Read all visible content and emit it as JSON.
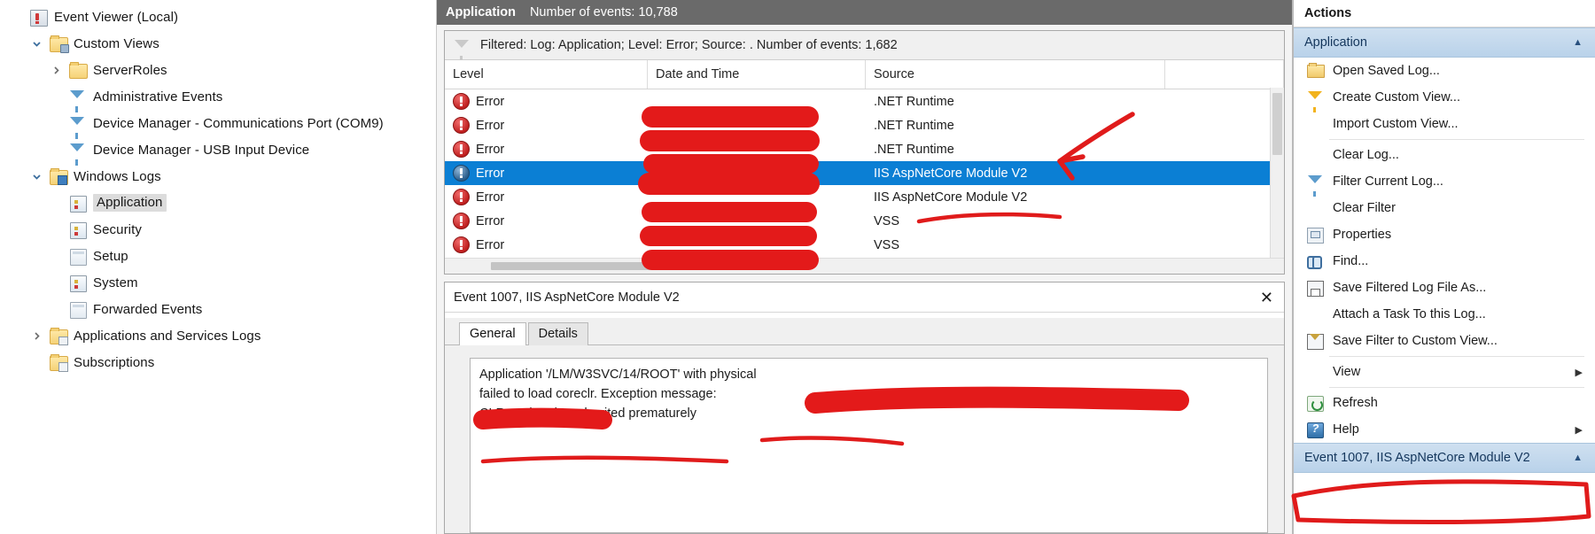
{
  "tree": {
    "items": [
      {
        "label": "Event Viewer (Local)",
        "icon": "event-viewer-icon",
        "indent": 0,
        "twisty": "",
        "selected": false
      },
      {
        "label": "Custom Views",
        "icon": "custom-views-folder-icon",
        "indent": 1,
        "twisty": "expanded",
        "selected": false
      },
      {
        "label": "ServerRoles",
        "icon": "folder-icon",
        "indent": 2,
        "twisty": "collapsed",
        "selected": false
      },
      {
        "label": "Administrative Events",
        "icon": "funnel-icon",
        "indent": 2,
        "twisty": "",
        "selected": false
      },
      {
        "label": "Device Manager - Communications Port (COM9)",
        "icon": "funnel-icon",
        "indent": 2,
        "twisty": "",
        "selected": false
      },
      {
        "label": "Device Manager - USB Input Device",
        "icon": "funnel-icon",
        "indent": 2,
        "twisty": "",
        "selected": false
      },
      {
        "label": "Windows Logs",
        "icon": "windows-logs-folder-icon",
        "indent": 1,
        "twisty": "expanded",
        "selected": false
      },
      {
        "label": "Application",
        "icon": "log-icon",
        "indent": 2,
        "twisty": "",
        "selected": true
      },
      {
        "label": "Security",
        "icon": "log-icon",
        "indent": 2,
        "twisty": "",
        "selected": false
      },
      {
        "label": "Setup",
        "icon": "plain-log-icon",
        "indent": 2,
        "twisty": "",
        "selected": false
      },
      {
        "label": "System",
        "icon": "log-icon",
        "indent": 2,
        "twisty": "",
        "selected": false
      },
      {
        "label": "Forwarded Events",
        "icon": "plain-log-icon",
        "indent": 2,
        "twisty": "",
        "selected": false
      },
      {
        "label": "Applications and Services Logs",
        "icon": "app-services-folder-icon",
        "indent": 1,
        "twisty": "collapsed",
        "selected": false
      },
      {
        "label": "Subscriptions",
        "icon": "subscriptions-folder-icon",
        "indent": 1,
        "twisty": "",
        "selected": false
      }
    ]
  },
  "center": {
    "log_title": "Application",
    "log_count": "Number of events: 10,788",
    "filter_text": "Filtered: Log: Application; Level: Error; Source: . Number of events: 1,682",
    "columns": [
      "Level",
      "Date and Time",
      "Source"
    ],
    "rows": [
      {
        "level": "Error",
        "date": "",
        "source": ".NET Runtime",
        "selected": false
      },
      {
        "level": "Error",
        "date": "",
        "source": ".NET Runtime",
        "selected": false
      },
      {
        "level": "Error",
        "date": "",
        "source": ".NET Runtime",
        "selected": false
      },
      {
        "level": "Error",
        "date": "",
        "source": "IIS AspNetCore Module V2",
        "selected": true
      },
      {
        "level": "Error",
        "date": "",
        "source": "IIS AspNetCore Module V2",
        "selected": false
      },
      {
        "level": "Error",
        "date": "",
        "source": "VSS",
        "selected": false
      },
      {
        "level": "Error",
        "date": "",
        "source": "VSS",
        "selected": false
      }
    ],
    "detail": {
      "title": "Event 1007, IIS AspNetCore Module V2",
      "close_label": "✕",
      "tabs": [
        {
          "label": "General",
          "active": true
        },
        {
          "label": "Details",
          "active": false
        }
      ],
      "message_line1": "Application '/LM/W3SVC/14/ROOT' with physical",
      "message_line2": "failed to load coreclr. Exception message:",
      "message_line3": "CLR worker thread exited prematurely"
    }
  },
  "actions": {
    "header": "Actions",
    "group_label": "Application",
    "group_caret": "▲",
    "items": [
      {
        "label": "Open Saved Log...",
        "icon": "open-folder-icon",
        "sep_before": false,
        "submenu": false
      },
      {
        "label": "Create Custom View...",
        "icon": "funnel-yellow-icon",
        "sep_before": false,
        "submenu": false
      },
      {
        "label": "Import Custom View...",
        "icon": "none",
        "sep_before": false,
        "submenu": false
      },
      {
        "label": "Clear Log...",
        "icon": "none",
        "sep_before": true,
        "submenu": false
      },
      {
        "label": "Filter Current Log...",
        "icon": "funnel-blue-icon",
        "sep_before": false,
        "submenu": false
      },
      {
        "label": "Clear Filter",
        "icon": "none",
        "sep_before": false,
        "submenu": false
      },
      {
        "label": "Properties",
        "icon": "properties-icon",
        "sep_before": false,
        "submenu": false
      },
      {
        "label": "Find...",
        "icon": "find-icon",
        "sep_before": false,
        "submenu": false
      },
      {
        "label": "Save Filtered Log File As...",
        "icon": "save-icon",
        "sep_before": false,
        "submenu": false
      },
      {
        "label": "Attach a Task To this Log...",
        "icon": "none",
        "sep_before": false,
        "submenu": false
      },
      {
        "label": "Save Filter to Custom View...",
        "icon": "save-filter-icon",
        "sep_before": false,
        "submenu": false
      },
      {
        "label": "View",
        "icon": "none",
        "sep_before": true,
        "submenu": true
      },
      {
        "label": "Refresh",
        "icon": "refresh-icon",
        "sep_before": true,
        "submenu": false
      },
      {
        "label": "Help",
        "icon": "help-icon",
        "sep_before": false,
        "submenu": true
      }
    ],
    "event_group_label": "Event 1007, IIS AspNetCore Module V2",
    "event_group_caret": "▲"
  },
  "colors": {
    "selection_blue": "#0b7fd4",
    "annotation_red": "#e31a1a",
    "title_bar_gray": "#6a6a6a",
    "group_header_blue": "#b9d2ea"
  }
}
